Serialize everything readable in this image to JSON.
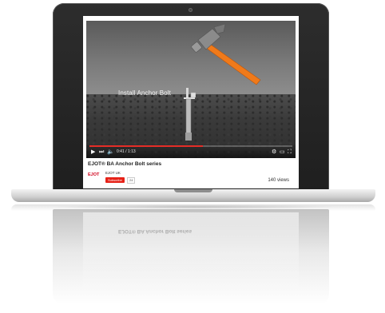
{
  "video": {
    "overlay_title": "Install Anchor Bolt",
    "time_display": "0:41 / 1:13",
    "progress": 0.56
  },
  "info": {
    "title": "EJOT® BA Anchor Bolt series",
    "channel_logo_text": "EJOT",
    "channel_name": "EJOT UK",
    "subscribe_label": "Subscribe",
    "subscriber_count": "24",
    "views": "140 views"
  },
  "icons": {
    "play": "play-icon",
    "next": "next-icon",
    "volume": "volume-icon",
    "settings": "gear-icon",
    "theater": "theater-mode-icon",
    "fullscreen": "fullscreen-icon"
  },
  "colors": {
    "progress": "#e52d27",
    "subscribe": "#e62117",
    "logo": "#d0021b",
    "hammer_handle": "#f07a1a"
  }
}
